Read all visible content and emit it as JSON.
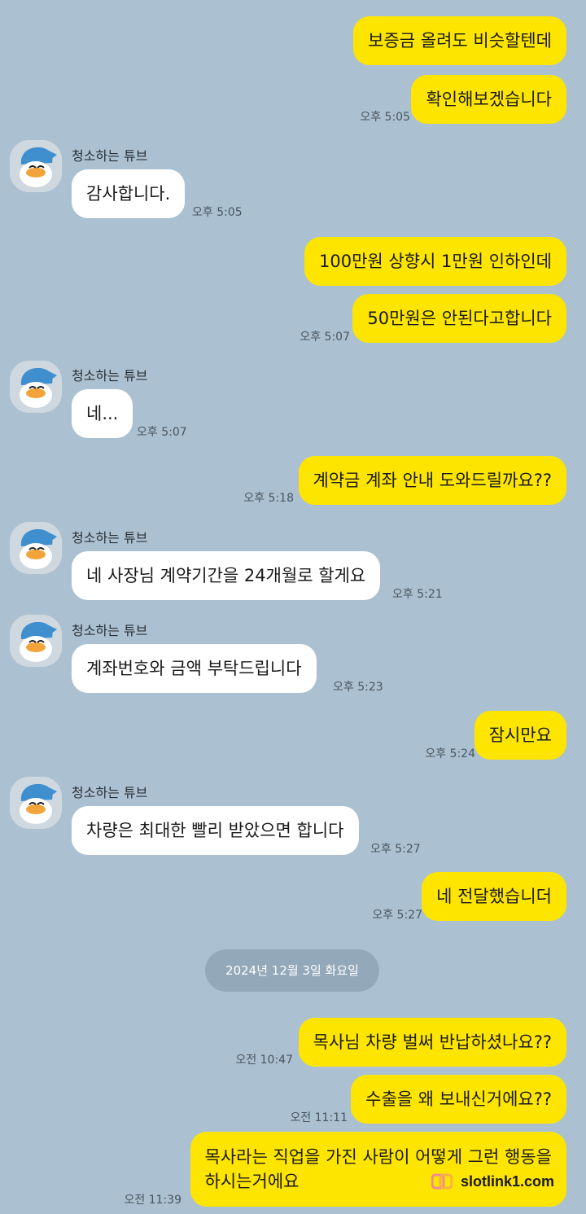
{
  "messages": {
    "m1": {
      "text": "보증금 올려도 비슷할텐데"
    },
    "m2": {
      "text": "확인해보겠습니다",
      "time": "오후 5:05"
    },
    "m3": {
      "sender": "청소하는 튜브",
      "text": "감사합니다.",
      "time": "오후 5:05"
    },
    "m4": {
      "text": "100만원 상향시 1만원 인하인데"
    },
    "m5": {
      "text": "50만원은 안된다고합니다",
      "time": "오후 5:07"
    },
    "m6": {
      "sender": "청소하는 튜브",
      "text": "네...",
      "time": "오후 5:07"
    },
    "m7": {
      "text": "계약금 계좌 안내 도와드릴까요??",
      "time": "오후 5:18"
    },
    "m8": {
      "sender": "청소하는 튜브",
      "text": "네 사장님 계약기간을 24개월로 할게요",
      "time": "오후 5:21"
    },
    "m9": {
      "sender": "청소하는 튜브",
      "text": "계좌번호와 금액 부탁드립니다",
      "time": "오후 5:23"
    },
    "m10": {
      "text": "잠시만요",
      "time": "오후 5:24"
    },
    "m11": {
      "sender": "청소하는 튜브",
      "text": "차량은 최대한 빨리 받았으면 합니다",
      "time": "오후 5:27"
    },
    "m12": {
      "text": "네 전달했습니더",
      "time": "오후 5:27"
    },
    "date": "2024년 12월 3일 화요일",
    "m13": {
      "text": "목사님 차량 벌써 반납하셨나요??",
      "time": "오전 10:47"
    },
    "m14": {
      "text": "수출을 왜 보내신거에요??",
      "time": "오전 11:11"
    },
    "m15": {
      "line1": "목사라는 직업을 가진 사람이 어떻게 그런 행동을",
      "line2": "하시는거에요",
      "time": "오전 11:39"
    }
  },
  "watermark": {
    "text": "slotlink1.com"
  },
  "colors": {
    "background": "#abc1d1",
    "my_bubble": "#fee500",
    "other_bubble": "#ffffff"
  },
  "icons": {
    "avatar": "tube-duck-avatar-icon",
    "watermark": "link-logo-icon"
  }
}
